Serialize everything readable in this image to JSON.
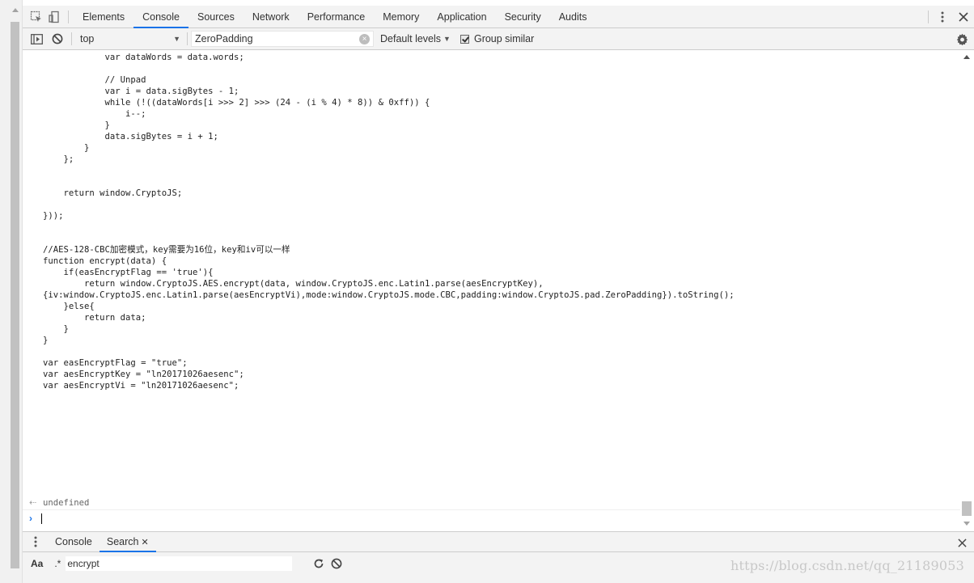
{
  "tabs": [
    "Elements",
    "Console",
    "Sources",
    "Network",
    "Performance",
    "Memory",
    "Application",
    "Security",
    "Audits"
  ],
  "active_tab": "Console",
  "toolbar": {
    "context": "top",
    "filter_value": "ZeroPadding",
    "levels": "Default levels",
    "group_similar": "Group similar"
  },
  "console": {
    "code": "            var dataWords = data.words;\n\n            // Unpad\n            var i = data.sigBytes - 1;\n            while (!((dataWords[i >>> 2] >>> (24 - (i % 4) * 8)) & 0xff)) {\n                i--;\n            }\n            data.sigBytes = i + 1;\n        }\n    };\n\n\n    return window.CryptoJS;\n\n}));\n\n\n//AES-128-CBC加密模式，key需要为16位，key和iv可以一样\nfunction encrypt(data) {\n    if(easEncryptFlag == 'true'){\n        return window.CryptoJS.AES.encrypt(data, window.CryptoJS.enc.Latin1.parse(aesEncryptKey),\n{iv:window.CryptoJS.enc.Latin1.parse(aesEncryptVi),mode:window.CryptoJS.mode.CBC,padding:window.CryptoJS.pad.ZeroPadding}).toString();\n    }else{\n        return data;\n    }\n}\n\nvar easEncryptFlag = \"true\";\nvar aesEncryptKey = \"ln20171026aesenc\";\nvar aesEncryptVi = \"ln20171026aesenc\";",
    "result": "undefined"
  },
  "drawer": {
    "tabs": [
      "Console",
      "Search"
    ],
    "active": "Search",
    "aa": "Aa",
    "regex": ".*",
    "search_value": "encrypt"
  },
  "watermark": "https://blog.csdn.net/qq_21189053"
}
